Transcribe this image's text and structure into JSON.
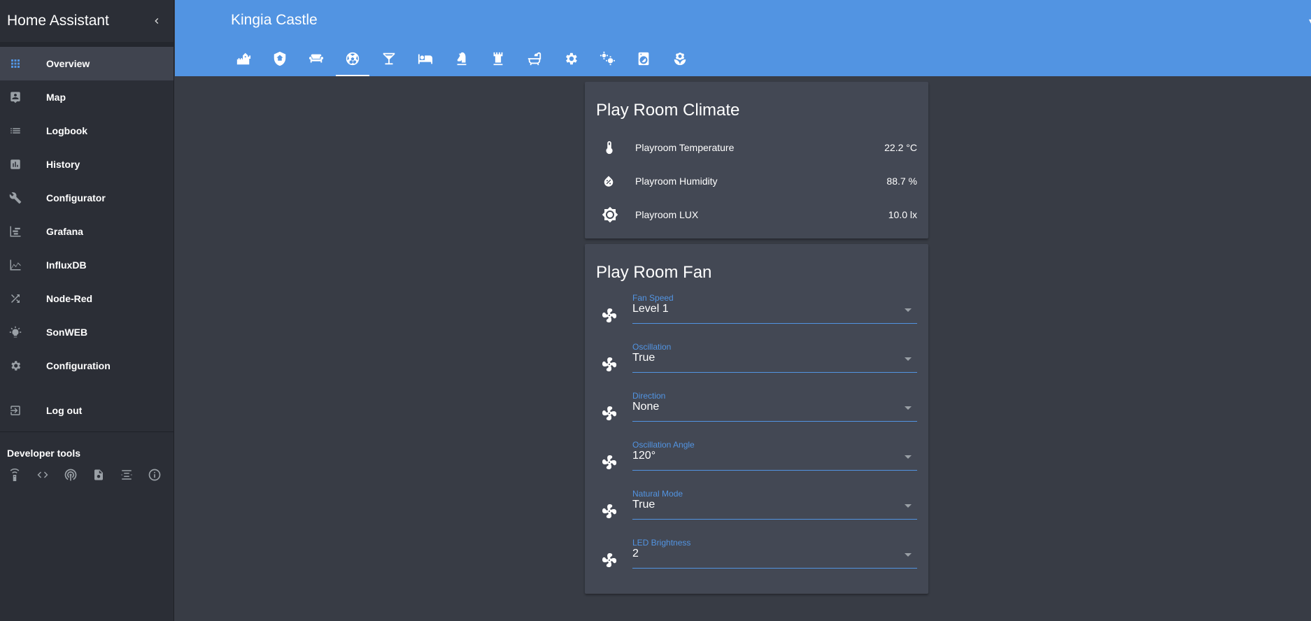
{
  "sidebar": {
    "title": "Home Assistant",
    "items": [
      {
        "label": "Overview",
        "icon": "apps-icon"
      },
      {
        "label": "Map",
        "icon": "map-icon"
      },
      {
        "label": "Logbook",
        "icon": "list-icon"
      },
      {
        "label": "History",
        "icon": "chart-bar-icon"
      },
      {
        "label": "Configurator",
        "icon": "wrench-icon"
      },
      {
        "label": "Grafana",
        "icon": "chart-timeline-icon"
      },
      {
        "label": "InfluxDB",
        "icon": "chart-areaspline-icon"
      },
      {
        "label": "Node-Red",
        "icon": "shuffle-icon"
      },
      {
        "label": "SonWEB",
        "icon": "lightbulb-icon"
      },
      {
        "label": "Configuration",
        "icon": "gear-icon"
      }
    ],
    "logout_label": "Log out",
    "dev_tools_title": "Developer tools",
    "dev_tools": [
      "remote-icon",
      "code-icon",
      "broadcast-icon",
      "file-icon",
      "template-icon",
      "info-icon"
    ]
  },
  "header": {
    "title": "Kingia Castle",
    "tabs": [
      {
        "icon": "castle-icon"
      },
      {
        "icon": "shield-home-icon"
      },
      {
        "icon": "sofa-icon"
      },
      {
        "icon": "soccer-icon",
        "active": true
      },
      {
        "icon": "glass-cocktail-icon"
      },
      {
        "icon": "bed-icon"
      },
      {
        "icon": "chess-knight-icon"
      },
      {
        "icon": "chess-rook-icon"
      },
      {
        "icon": "bathtub-icon"
      },
      {
        "icon": "gear-icon"
      },
      {
        "icon": "settings-icon"
      },
      {
        "icon": "washing-machine-icon"
      },
      {
        "icon": "flower-icon"
      }
    ]
  },
  "climate": {
    "title": "Play Room Climate",
    "rows": [
      {
        "name": "Playroom Temperature",
        "value": "22.2 °C",
        "icon": "thermometer-icon"
      },
      {
        "name": "Playroom Humidity",
        "value": "88.7 %",
        "icon": "water-percent-icon"
      },
      {
        "name": "Playroom LUX",
        "value": "10.0 lx",
        "icon": "brightness-icon"
      }
    ]
  },
  "fan": {
    "title": "Play Room Fan",
    "rows": [
      {
        "label": "Fan Speed",
        "value": "Level 1",
        "icon": "fan-icon"
      },
      {
        "label": "Oscillation",
        "value": "True",
        "icon": "fan-icon"
      },
      {
        "label": "Direction",
        "value": "None",
        "icon": "fan-icon"
      },
      {
        "label": "Oscillation Angle",
        "value": "120°",
        "icon": "fan-icon"
      },
      {
        "label": "Natural Mode",
        "value": "True",
        "icon": "fan-icon"
      },
      {
        "label": "LED Brightness",
        "value": "2",
        "icon": "fan-icon"
      }
    ]
  },
  "colors": {
    "accent": "#5294e2",
    "sidebar": "#2b2e36",
    "card": "#434854",
    "background": "#383c45"
  }
}
